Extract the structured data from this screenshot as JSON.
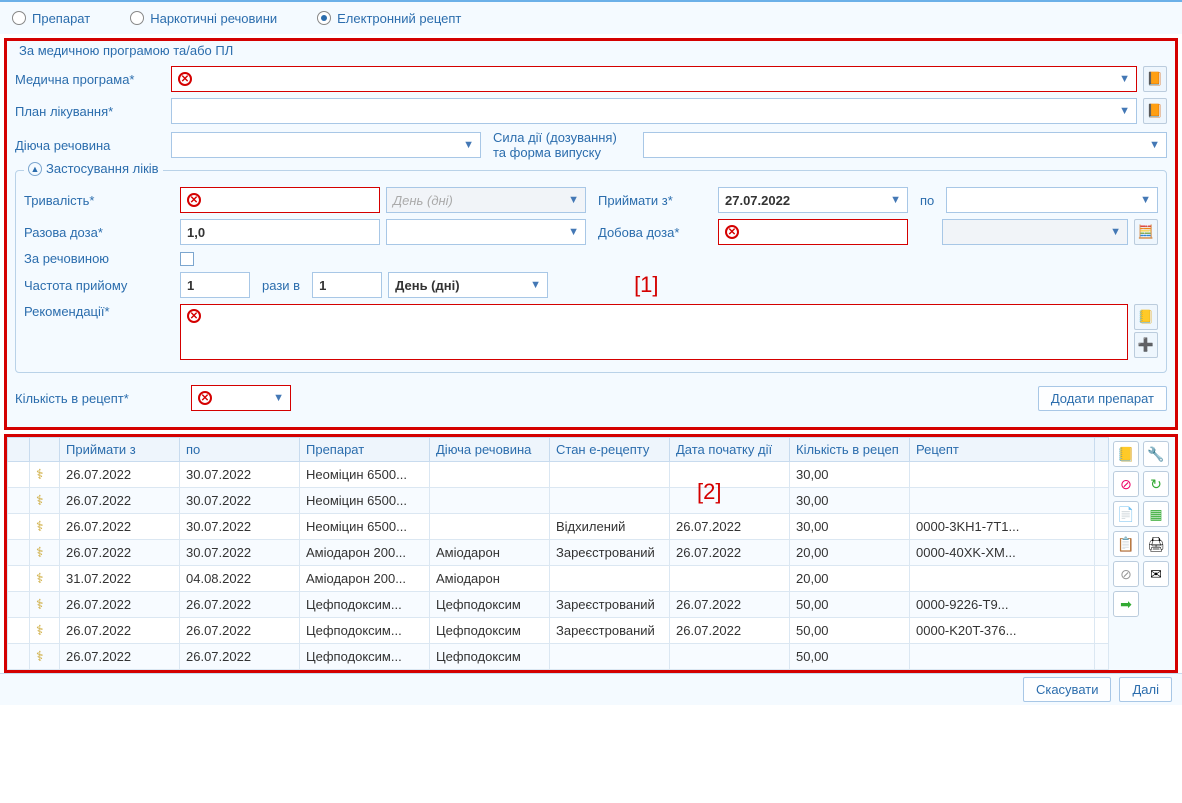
{
  "tabs": {
    "preparat": "Препарат",
    "narcotic": "Наркотичні речовини",
    "erecept": "Електронний рецепт"
  },
  "section_program_title": "За медичною програмою та/або ПЛ",
  "labels": {
    "med_program": "Медична програма*",
    "treat_plan": "План лікування*",
    "active_subst": "Діюча речовина",
    "strength": "Сила дії (дозування) та форма випуску",
    "usage_group": "Застосування ліків",
    "duration": "Тривалість*",
    "duration_unit_ph": "День (дні)",
    "take_from": "Приймати з*",
    "to": "по",
    "single_dose": "Разова доза*",
    "daily_dose": "Добова доза*",
    "by_substance": "За речовиною",
    "frequency": "Частота прийому",
    "times_in": "рази в",
    "freq_unit": "День (дні)",
    "recommend": "Рекомендації*",
    "qty_in_recipe": "Кількість в рецепт*",
    "add_preparat": "Додати препарат"
  },
  "values": {
    "take_from": "27.07.2022",
    "single_dose": "1,0",
    "freq1": "1",
    "freq2": "1"
  },
  "marks": {
    "m1": "[1]",
    "m2": "[2]"
  },
  "table": {
    "headers": {
      "c0": "",
      "c1": "",
      "from": "Приймати з",
      "to": "по",
      "prep": "Препарат",
      "subst": "Діюча речовина",
      "status": "Стан е-рецепту",
      "start": "Дата початку дії",
      "qty": "Кількість в рецеп",
      "recipe": "Рецепт"
    },
    "rows": [
      {
        "from": "26.07.2022",
        "to": "30.07.2022",
        "prep": "Неоміцин 6500...",
        "subst": "",
        "status": "",
        "start": "",
        "qty": "30,00",
        "recipe": ""
      },
      {
        "from": "26.07.2022",
        "to": "30.07.2022",
        "prep": "Неоміцин 6500...",
        "subst": "",
        "status": "",
        "start": "",
        "qty": "30,00",
        "recipe": ""
      },
      {
        "from": "26.07.2022",
        "to": "30.07.2022",
        "prep": "Неоміцин 6500...",
        "subst": "",
        "status": "Відхилений",
        "start": "26.07.2022",
        "qty": "30,00",
        "recipe": "0000-3KH1-7T1..."
      },
      {
        "from": "26.07.2022",
        "to": "30.07.2022",
        "prep": "Аміодарон 200...",
        "subst": "Аміодарон",
        "status": "Зареєстрований",
        "start": "26.07.2022",
        "qty": "20,00",
        "recipe": "0000-40XK-XM..."
      },
      {
        "from": "31.07.2022",
        "to": "04.08.2022",
        "prep": "Аміодарон 200...",
        "subst": "Аміодарон",
        "status": "",
        "start": "",
        "qty": "20,00",
        "recipe": ""
      },
      {
        "from": "26.07.2022",
        "to": "26.07.2022",
        "prep": "Цефподоксим...",
        "subst": "Цефподоксим",
        "status": "Зареєстрований",
        "start": "26.07.2022",
        "qty": "50,00",
        "recipe": "0000-9226-T9..."
      },
      {
        "from": "26.07.2022",
        "to": "26.07.2022",
        "prep": "Цефподоксим...",
        "subst": "Цефподоксим",
        "status": "Зареєстрований",
        "start": "26.07.2022",
        "qty": "50,00",
        "recipe": "0000-K20T-376..."
      },
      {
        "from": "26.07.2022",
        "to": "26.07.2022",
        "prep": "Цефподоксим...",
        "subst": "Цефподоксим",
        "status": "",
        "start": "",
        "qty": "50,00",
        "recipe": ""
      }
    ]
  },
  "footer": {
    "cancel": "Скасувати",
    "next": "Далі"
  }
}
